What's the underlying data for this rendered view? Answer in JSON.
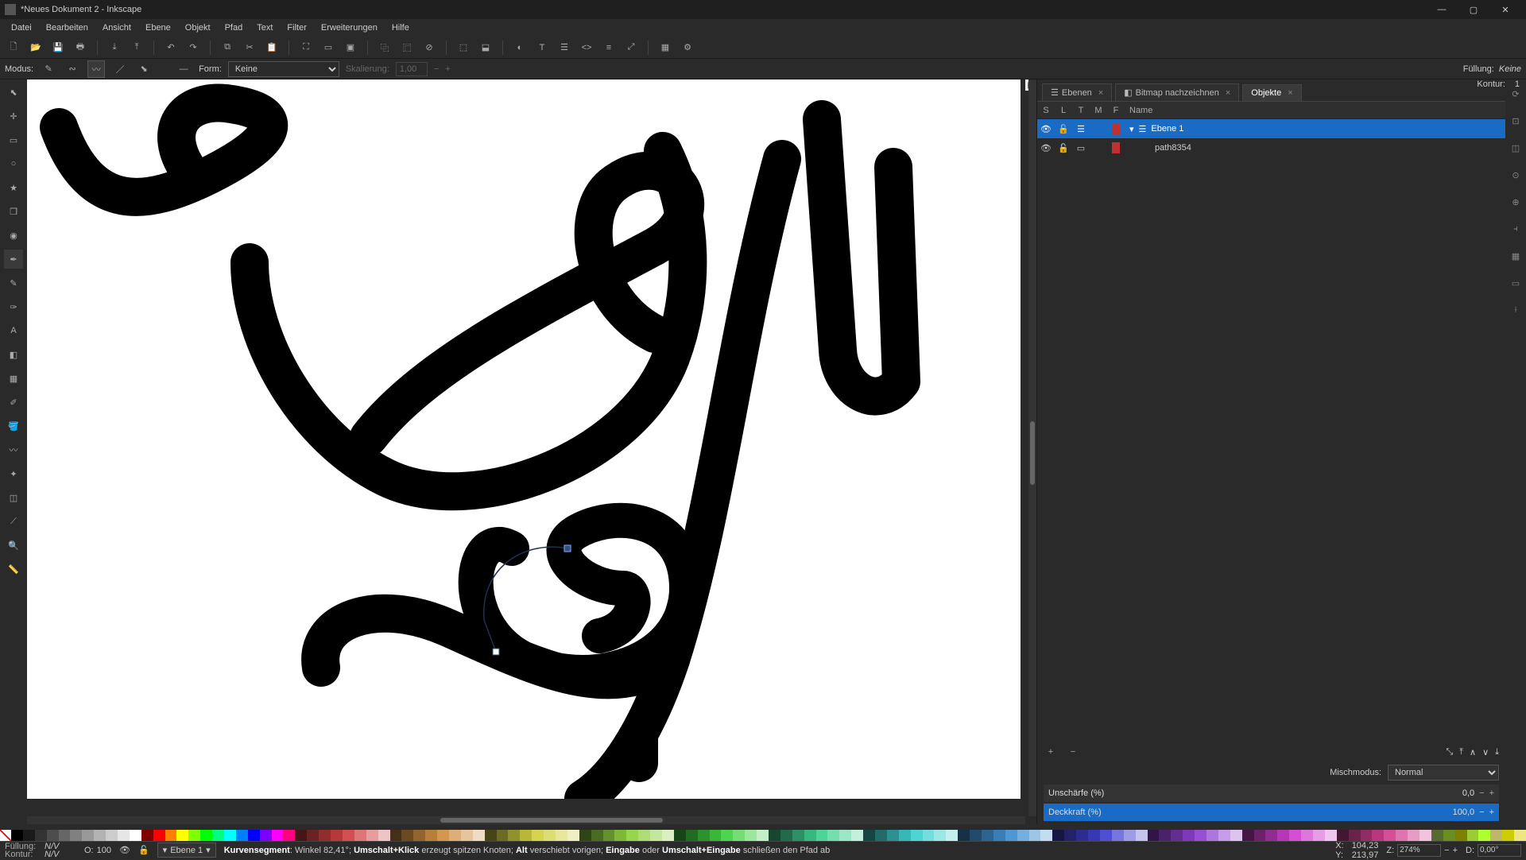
{
  "title": "*Neues Dokument 2 - Inkscape",
  "menu": [
    "Datei",
    "Bearbeiten",
    "Ansicht",
    "Ebene",
    "Objekt",
    "Pfad",
    "Text",
    "Filter",
    "Erweiterungen",
    "Hilfe"
  ],
  "tooloptions": {
    "modus_label": "Modus:",
    "form_label": "Form:",
    "form_value": "Keine",
    "scale_label": "Skalierung:",
    "scale_value": "1,00",
    "fill_label": "Füllung:",
    "fill_value": "Keine",
    "stroke_label": "Kontur:",
    "stroke_value": "1"
  },
  "dock": {
    "tabs": [
      {
        "label": "Ebenen",
        "active": false
      },
      {
        "label": "Bitmap nachzeichnen",
        "active": false
      },
      {
        "label": "Objekte",
        "active": true
      }
    ],
    "header": {
      "s": "S",
      "l": "L",
      "t": "T",
      "m": "M",
      "f": "F",
      "name": "Name"
    },
    "rows": [
      {
        "name": "Ebene 1",
        "selected": true,
        "expand": true,
        "visible": true,
        "locked": false
      },
      {
        "name": "path8354",
        "selected": false,
        "expand": false,
        "visible": true,
        "locked": false
      }
    ],
    "blendmode_label": "Mischmodus:",
    "blendmode_value": "Normal",
    "blur_label": "Unschärfe (%)",
    "blur_value": "0,0",
    "opacity_label": "Deckkraft (%)",
    "opacity_value": "100,0"
  },
  "status": {
    "fill_lbl": "Füllung:",
    "fill_val": "N/V",
    "stroke_lbl": "Kontur:",
    "stroke_val": "N/V",
    "o_lbl": "O:",
    "o_val": "100",
    "layer": "Ebene 1",
    "hint_seg": "Kurvensegment",
    "hint_angle": ": Winkel 82,41°; ",
    "hint_k1": "Umschalt+Klick",
    "hint_t1": " erzeugt spitzen Knoten; ",
    "hint_k2": "Alt",
    "hint_t2": " verschiebt vorigen; ",
    "hint_k3": "Eingabe",
    "hint_t3": " oder ",
    "hint_k4": "Umschalt+Eingabe",
    "hint_t4": " schließen den Pfad ab",
    "x_lbl": "X:",
    "x_val": "104,23",
    "y_lbl": "Y:",
    "y_val": "213,97",
    "z_lbl": "Z:",
    "z_val": "274%",
    "d_lbl": "D:",
    "d_val": "0,00°"
  },
  "palette_colors": [
    "#000",
    "#1a1a1a",
    "#333",
    "#4d4d4d",
    "#666",
    "#808080",
    "#999",
    "#b3b3b3",
    "#ccc",
    "#e6e6e6",
    "#fff",
    "#800000",
    "#f00",
    "#ff8000",
    "#ff0",
    "#80ff00",
    "#0f0",
    "#00ff80",
    "#0ff",
    "#0080ff",
    "#00f",
    "#8000ff",
    "#f0f",
    "#ff0080",
    "#451616",
    "#6b2222",
    "#912d2d",
    "#b73838",
    "#d44f4f",
    "#dd7676",
    "#e69d9d",
    "#efc4c4",
    "#453016",
    "#6b4a22",
    "#91652d",
    "#b77f38",
    "#d4974f",
    "#ddae76",
    "#e6c59d",
    "#efdcc4",
    "#454516",
    "#6b6b22",
    "#91912d",
    "#b7b738",
    "#d4d44f",
    "#dddd76",
    "#e6e69d",
    "#efefc4",
    "#304516",
    "#4a6b22",
    "#65912d",
    "#7fb738",
    "#97d44f",
    "#aedd76",
    "#c5e69d",
    "#dcefc4",
    "#164516",
    "#226b22",
    "#2d912d",
    "#38b738",
    "#4fd44f",
    "#76dd76",
    "#9de69d",
    "#c4efc4",
    "#164530",
    "#226b4a",
    "#2d9165",
    "#38b77f",
    "#4fd497",
    "#76ddae",
    "#9de6c5",
    "#c4efdc",
    "#164545",
    "#226b6b",
    "#2d9191",
    "#38b7b7",
    "#4fd4d4",
    "#76dddd",
    "#9de6e6",
    "#c4efef",
    "#163045",
    "#224a6b",
    "#2d6591",
    "#387fb7",
    "#4f97d4",
    "#76aedd",
    "#9dc5e6",
    "#c4dcef",
    "#161645",
    "#22226b",
    "#2d2d91",
    "#3838b7",
    "#4f4fd4",
    "#7676dd",
    "#9d9de6",
    "#c4c4ef",
    "#301645",
    "#4a226b",
    "#652d91",
    "#7f38b7",
    "#974fd4",
    "#ae76dd",
    "#c59de6",
    "#dcc4ef",
    "#451645",
    "#6b226b",
    "#912d91",
    "#b738b7",
    "#d44fd4",
    "#dd76dd",
    "#e69de6",
    "#efc4ef",
    "#451630",
    "#6b224a",
    "#912d65",
    "#b7387f",
    "#d44f97",
    "#dd76ae",
    "#e69dc5",
    "#efc4dc",
    "#556b2f",
    "#6b8e23",
    "#808000",
    "#9acd32",
    "#adff2f",
    "#bdb76b",
    "#cdcd00",
    "#eee685"
  ]
}
